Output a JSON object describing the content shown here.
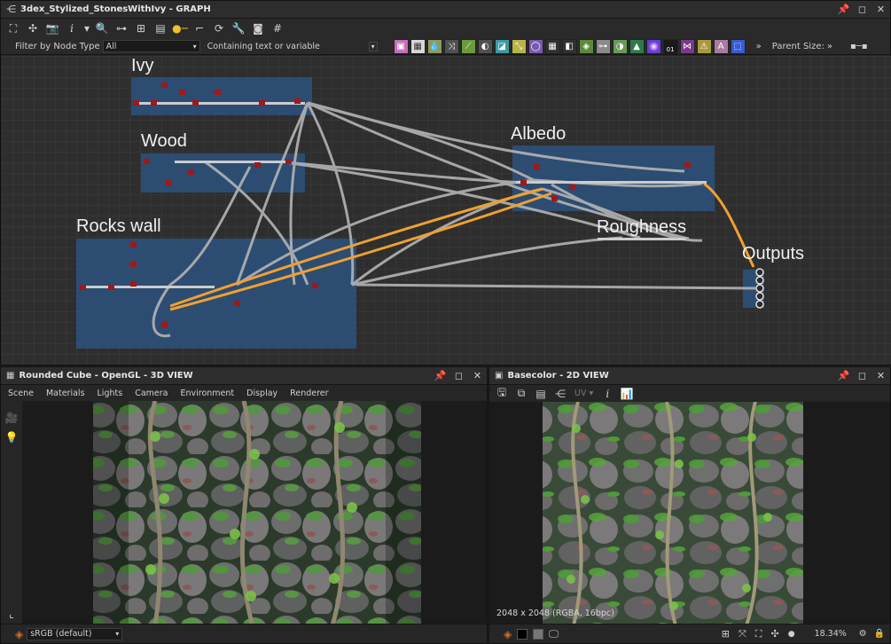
{
  "graph_window": {
    "title": "3dex_Stylized_StonesWithIvy - GRAPH",
    "filter_label": "Filter by Node Type",
    "filter_value": "All",
    "search_placeholder": "Containing text or variable",
    "parent_size_label": "Parent Size:",
    "frames": [
      {
        "id": "ivy",
        "label": "Ivy"
      },
      {
        "id": "wood",
        "label": "Wood"
      },
      {
        "id": "rocks",
        "label": "Rocks wall"
      },
      {
        "id": "albedo",
        "label": "Albedo"
      },
      {
        "id": "roughness",
        "label": "Roughness"
      },
      {
        "id": "outputs",
        "label": "Outputs"
      }
    ],
    "chip_labels": {
      "levels": "01",
      "text": "A"
    }
  },
  "view3d": {
    "title": "Rounded Cube - OpenGL - 3D VIEW",
    "menu": [
      "Scene",
      "Materials",
      "Lights",
      "Camera",
      "Environment",
      "Display",
      "Renderer"
    ],
    "colorspace": "sRGB (default)"
  },
  "view2d": {
    "title": "Basecolor - 2D VIEW",
    "uv_label": "UV",
    "image_info": "2048 x 2048 (RGBA, 16bpc)",
    "zoom": "18.34%"
  },
  "colors": {
    "frame": "#2c4f78",
    "accent_orange": "#f0a030",
    "moss": "#4f9a3a"
  }
}
